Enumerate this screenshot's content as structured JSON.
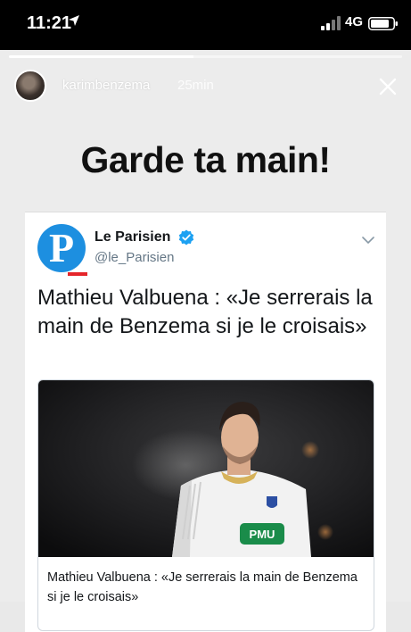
{
  "status_bar": {
    "time": "11:21",
    "network": "4G"
  },
  "story": {
    "progress": 0.47,
    "username": "karimbenzema",
    "timestamp": "25min",
    "headline": "Garde ta main!"
  },
  "tweet": {
    "account_name": "Le Parisien",
    "handle": "@le_Parisien",
    "logo_letter": "P",
    "text": "Mathieu Valbuena : «Je serrerais la main de Benzema si je le croisais»",
    "preview": {
      "title": "Mathieu Valbuena : «Je serrerais la main de Benzema si je le croisais»",
      "shirt_sponsor": "PMU"
    }
  },
  "colors": {
    "accent_blue": "#1d8fe0",
    "verified_blue": "#1da1f2",
    "logo_red": "#e5252a"
  },
  "icons": [
    "location-arrow-icon",
    "signal-icon",
    "battery-icon",
    "close-icon",
    "verified-icon",
    "chevron-down-icon"
  ]
}
